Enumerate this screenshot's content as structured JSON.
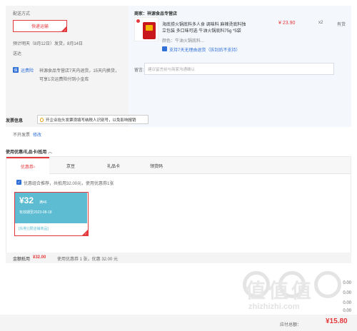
{
  "delivery": {
    "title": "配送方式",
    "option_label": "快递运输",
    "estimate": "预计明天（8月12日）发货，8月14日",
    "arrive": "送达",
    "service_badge": "运费险",
    "service_text_1": "祥源食品专营店7天内退货，15天内换货，",
    "service_text_2": "可享1次运费险付到小金库"
  },
  "shop": {
    "seller_label": "商家：祥源食品专营店",
    "product_title_1": "海底捞火锅底料多人食 调味料 麻辣烫底料独",
    "product_title_2": "立包装 多口味可选 牛油火锅底料75g *5袋",
    "color_label": "颜色：牛油火锅底料...",
    "refund_text": "支持7天无理由退货（拆封后不支持）",
    "price": "¥ 23.90",
    "quantity": "x2",
    "stock_status": "有货",
    "message_label": "留言:",
    "message_placeholder": "建议留言前与商家沟通确认"
  },
  "invoice": {
    "title": "发票信息",
    "tip": "开企业抬头发票须填写纳税人识别号，以免影响报销",
    "status": "不开发票",
    "edit_link": "修改"
  },
  "coupons": {
    "section_title": "使用优惠/礼品卡/抵用",
    "tabs": [
      "优惠券",
      "京豆",
      "礼品卡",
      "领货码"
    ],
    "active_tab_badge": "1",
    "combo_text": "优惠组合推荐，共抵用32.00元，使用优惠券1张",
    "coupon_amount": "¥32",
    "coupon_condition": "满46",
    "coupon_validity": "有效期至2023-08-18",
    "coupon_tags": "[东券] [限店铺商品]",
    "summary_label": "金额抵用",
    "summary_amount": "¥32.00",
    "summary_detail": "使用优惠券 1 张，优惠 32.00 元"
  },
  "totals": {
    "rows": [
      "0.00",
      "0.00",
      "0.00",
      "0.00"
    ],
    "pay_label": "应付总额：",
    "pay_amount": "¥15.80"
  },
  "watermark": {
    "title": "值值值",
    "url": "zhizhizhi.com"
  },
  "colors": {
    "accent": "#e4393c",
    "link": "#2f6fd8",
    "coupon_bg": "#5dbcd2"
  }
}
